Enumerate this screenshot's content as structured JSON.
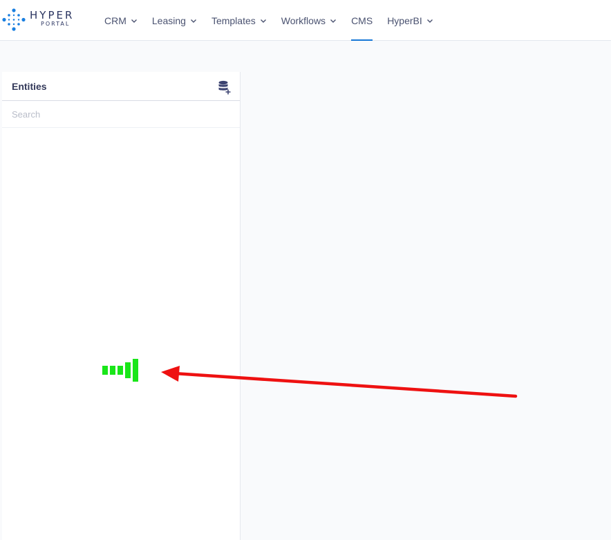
{
  "brand": {
    "name": "HYPER",
    "subname": "PORTAL",
    "color": "#2b3561",
    "dot_color": "#1a7fe0"
  },
  "nav": {
    "items": [
      {
        "label": "CRM",
        "has_dropdown": true,
        "active": false
      },
      {
        "label": "Leasing",
        "has_dropdown": true,
        "active": false
      },
      {
        "label": "Templates",
        "has_dropdown": true,
        "active": false
      },
      {
        "label": "Workflows",
        "has_dropdown": true,
        "active": false
      },
      {
        "label": "CMS",
        "has_dropdown": false,
        "active": true
      },
      {
        "label": "HyperBI",
        "has_dropdown": true,
        "active": false
      }
    ],
    "active_color": "#1677d6"
  },
  "entities_panel": {
    "title": "Entities",
    "add_icon": "database-add-icon",
    "search": {
      "placeholder": "Search",
      "value": ""
    },
    "loading_icon": "signal-bars-loading-icon",
    "loading_color": "#19e619"
  },
  "annotation": {
    "icon": "arrow-left-icon",
    "color": "#ee1111"
  }
}
